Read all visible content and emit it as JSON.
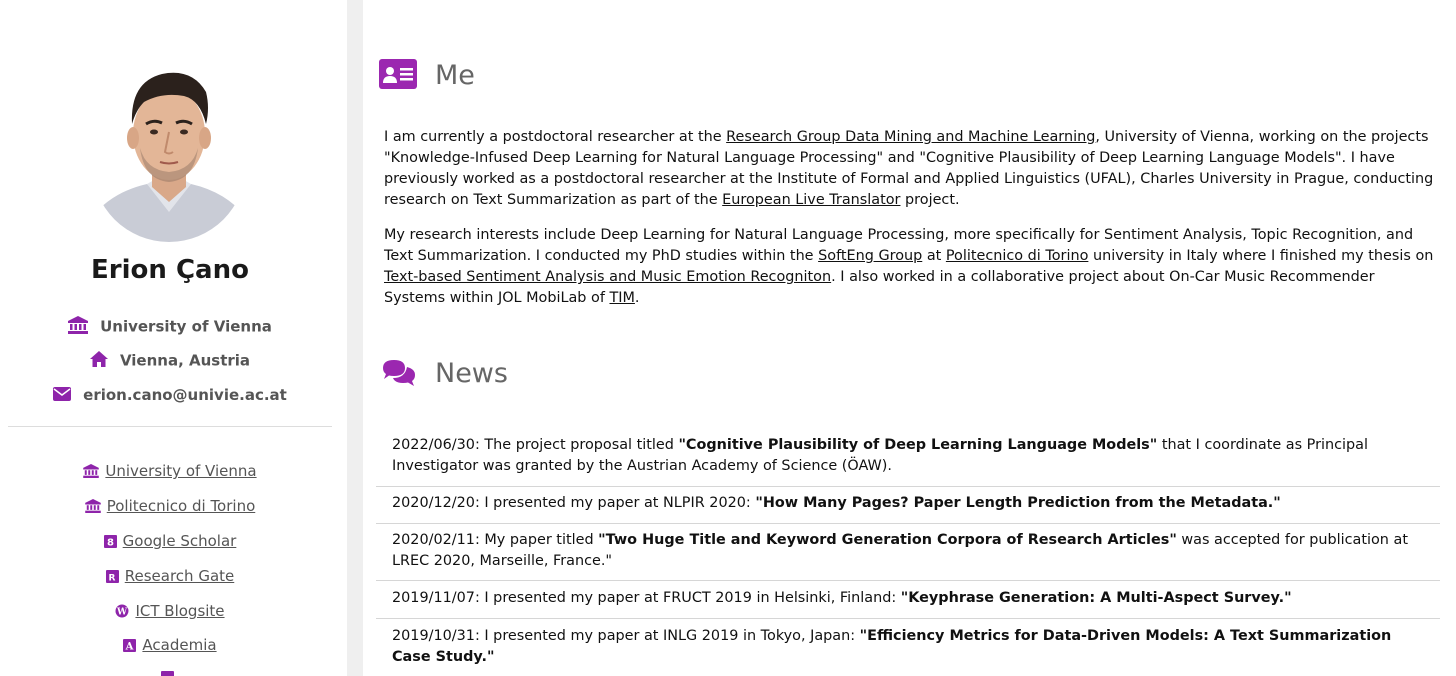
{
  "profile": {
    "name": "Erion Çano",
    "affiliation": "University of Vienna",
    "location": "Vienna, Austria",
    "email": "erion.cano@univie.ac.at"
  },
  "links": [
    {
      "label": "University of Vienna",
      "icon": "university-icon"
    },
    {
      "label": "Politecnico di Torino",
      "icon": "university-icon"
    },
    {
      "label": "Google Scholar",
      "icon": "google-scholar-icon"
    },
    {
      "label": "Research Gate",
      "icon": "researchgate-icon"
    },
    {
      "label": "ICT Blogsite",
      "icon": "wordpress-icon"
    },
    {
      "label": "Academia",
      "icon": "academia-icon"
    }
  ],
  "me": {
    "title": "Me",
    "p1_a": "I am currently a postdoctoral researcher at the ",
    "p1_link1": "Research Group Data Mining and Machine Learning",
    "p1_b": ", University of Vienna, working on the projects \"Knowledge-Infused Deep Learning for Natural Language Processing\" and \"Cognitive Plausibility of Deep Learning Language Models\". I have previously worked as a postdoctoral researcher at the Institute of Formal and Applied Linguistics (UFAL), Charles University in Prague, conducting research on Text Summarization as part of the ",
    "p1_link2": "European Live Translator",
    "p1_c": " project.",
    "p2_a": "My research interests include Deep Learning for Natural Language Processing, more specifically for Sentiment Analysis, Topic Recognition, and Text Summarization. I conducted my PhD studies within the ",
    "p2_link1": "SoftEng Group",
    "p2_b": " at ",
    "p2_link2": "Politecnico di Torino",
    "p2_c": " university in Italy where I finished my thesis on ",
    "p2_link3": "Text-based Sentiment Analysis and Music Emotion Recogniton",
    "p2_d": ". I also worked in a collaborative project about On-Car Music Recommender Systems within JOL MobiLab of ",
    "p2_link4": "TIM",
    "p2_e": "."
  },
  "news": {
    "title": "News",
    "items": [
      {
        "pre": "2022/06/30: The project proposal titled ",
        "bold": "\"Cognitive Plausibility of Deep Learning Language Models\"",
        "post": " that I coordinate as Principal Investigator was granted by the Austrian Academy of Science (ÖAW)."
      },
      {
        "pre": "2020/12/20: I presented my paper at NLPIR 2020: ",
        "q1": "\"",
        "link": "How Many Pages? Paper Length Prediction from the Metadata.",
        "q2": "\"",
        "post": ""
      },
      {
        "pre": "2020/02/11: My paper titled ",
        "q1": "\"",
        "link": "Two Huge Title and Keyword Generation Corpora of Research Articles",
        "q2": "\"",
        "post": " was accepted for publication at LREC 2020, Marseille, France.\""
      },
      {
        "pre": "2019/11/07: I presented my paper at FRUCT 2019 in Helsinki, Finland: ",
        "q1": "\"",
        "link": "Keyphrase Generation: A Multi-Aspect Survey.",
        "q2": "\"",
        "post": ""
      },
      {
        "pre": "2019/10/31: I presented my paper at INLG 2019 in Tokyo, Japan: ",
        "q1": "\"",
        "link": "Efficiency Metrics for Data-Driven Models: A Text Summarization Case Study.",
        "q2": "\"",
        "post": ""
      }
    ]
  },
  "colors": {
    "accent": "#9b27b0",
    "icon_purple": "#8e24aa"
  }
}
